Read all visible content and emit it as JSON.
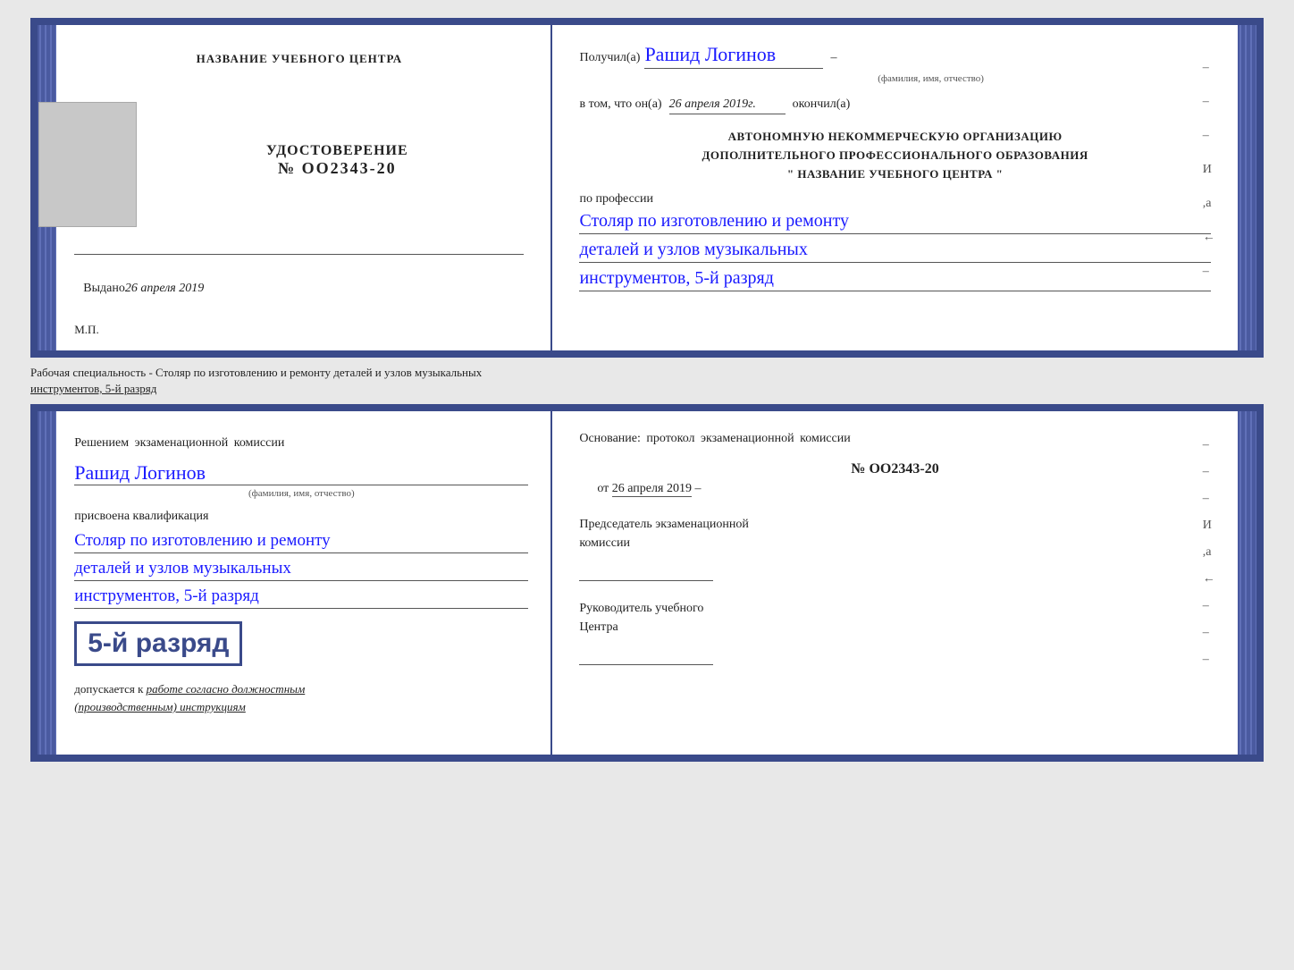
{
  "top_document": {
    "left": {
      "school_name": "НАЗВАНИЕ УЧЕБНОГО ЦЕНТРА",
      "udostoverenie_title": "УДОСТОВЕРЕНИЕ",
      "number": "№ OO2343-20",
      "vydano_label": "Выдано",
      "vydano_date": "26 апреля 2019",
      "mp": "М.П."
    },
    "right": {
      "poluchil_label": "Получил(а)",
      "recipient_name": "Рашид Логинов",
      "fio_caption": "(фамилия, имя, отчество)",
      "dash": "–",
      "vtom_label": "в том, что он(а)",
      "vtom_date": "26 апреля 2019г.",
      "okonchil_label": "окончил(а)",
      "org_line1": "АВТОНОМНУЮ НЕКОММЕРЧЕСКУЮ ОРГАНИЗАЦИЮ",
      "org_line2": "ДОПОЛНИТЕЛЬНОГО ПРОФЕССИОНАЛЬНОГО ОБРАЗОВАНИЯ",
      "org_name": "\" НАЗВАНИЕ УЧЕБНОГО ЦЕНТРА \"",
      "po_professii": "по профессии",
      "profession_line1": "Столяр по изготовлению и ремонту",
      "profession_line2": "деталей и узлов музыкальных",
      "profession_line3": "инструментов, 5-й разряд",
      "dashes": [
        "–",
        "–",
        "–",
        "И",
        ",а",
        "←",
        "–"
      ]
    }
  },
  "specialnost_text": "Рабочая специальность - Столяр по изготовлению и ремонту деталей и узлов музыкальных",
  "specialnost_text2": "инструментов, 5-й разряд",
  "bottom_document": {
    "left": {
      "resheniem_text": "Решением экзаменационной комиссии",
      "name": "Рашид Логинов",
      "fio_caption": "(фамилия, имя, отчество)",
      "prisvoena_text": "присвоена квалификация",
      "profession_line1": "Столяр по изготовлению и ремонту",
      "profession_line2": "деталей и узлов музыкальных",
      "profession_line3": "инструментов, 5-й разряд",
      "razryad_text": "5-й разряд",
      "dopuskaetsya_label": "допускается к",
      "dopuskaetsya_value": "работе согласно должностным",
      "dopuskaetsya_value2": "(производственным) инструкциям"
    },
    "right": {
      "osnovanie_text": "Основание: протокол экзаменационной комиссии",
      "protocol_number": "№ OO2343-20",
      "ot_label": "от",
      "ot_date": "26 апреля 2019",
      "predsedatel_line1": "Председатель экзаменационной",
      "predsedatel_line2": "комиссии",
      "rukovoditel_line1": "Руководитель учебного",
      "rukovoditel_line2": "Центра",
      "dashes": [
        "–",
        "–",
        "–",
        "И",
        ",а",
        "←",
        "–",
        "–",
        "–"
      ]
    }
  }
}
